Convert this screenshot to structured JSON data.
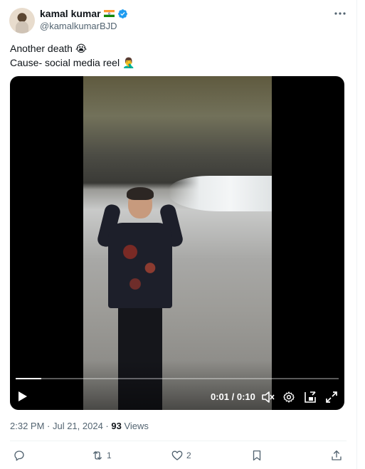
{
  "author": {
    "name": "kamal kumar",
    "flag": "indian-flag-emoji",
    "handle": "@kamalkumarBJD"
  },
  "tweet": {
    "line1": "Another death 😭",
    "line2": "Cause- social media reel 🤦‍♂️"
  },
  "video": {
    "timecode": "0:01 / 0:10",
    "progress": 0.08
  },
  "meta": {
    "timestamp": "2:32 PM · Jul 21, 2024 · ",
    "views_count": "93",
    "views_label": " Views"
  },
  "actions": {
    "reply_count": "",
    "retweet_count": "1",
    "like_count": "2"
  },
  "colors": {
    "verified": "#1d9bf0",
    "muted_text": "#536471"
  }
}
